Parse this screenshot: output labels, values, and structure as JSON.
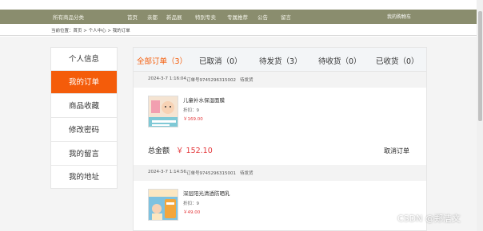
{
  "nav": {
    "all_categories": "所有商品分类",
    "items": [
      "首页",
      "亲都",
      "新品展",
      "特别专卖",
      "专属推荐",
      "公告",
      "留言"
    ],
    "cart": "我的购物车"
  },
  "breadcrumb": "当前位置：首页 > 个人中心 > 我的订单",
  "sidebar": {
    "items": [
      {
        "label": "个人信息",
        "active": false
      },
      {
        "label": "我的订单",
        "active": true
      },
      {
        "label": "商品收藏",
        "active": false
      },
      {
        "label": "修改密码",
        "active": false
      },
      {
        "label": "我的留言",
        "active": false
      },
      {
        "label": "我的地址",
        "active": false
      }
    ]
  },
  "tabs": [
    {
      "label": "全部订单（3）",
      "active": true
    },
    {
      "label": "已取消（0）",
      "active": false
    },
    {
      "label": "待发货（3）",
      "active": false
    },
    {
      "label": "待收货（0）",
      "active": false
    },
    {
      "label": "已收货（0）",
      "active": false
    }
  ],
  "orders": [
    {
      "date": "2024-3-7 1:16:04",
      "order_no": "订单号9745296315002",
      "status": "待发货",
      "product_name": "儿童补水保湿面膜",
      "discount": "折扣：9",
      "price": "￥169.00",
      "img_text": "儿童面膜",
      "img_colors": {
        "top": "#f5e4d2",
        "bottom": "#7fc9d6",
        "accent": "#f29fb0"
      },
      "total_label": "总金额",
      "total_value": "￥ 152.10",
      "cancel_label": "取消订单"
    },
    {
      "date": "2024-3-7 1:14:56",
      "order_no": "订单号9745296315001",
      "status": "待发货",
      "product_name": "深层阳光清透防晒乳",
      "discount": "折扣：9",
      "price": "￥49.00",
      "img_text": "儿童防晒",
      "img_colors": {
        "top": "#7ec2e0",
        "bottom": "#f3a63b",
        "accent": "#fbe7c2"
      }
    }
  ],
  "watermark": "CSDN @郑洁文",
  "colors": {
    "accent": "#f45c0a",
    "price": "#e4393c",
    "nav_bg": "#8a8d6e"
  }
}
